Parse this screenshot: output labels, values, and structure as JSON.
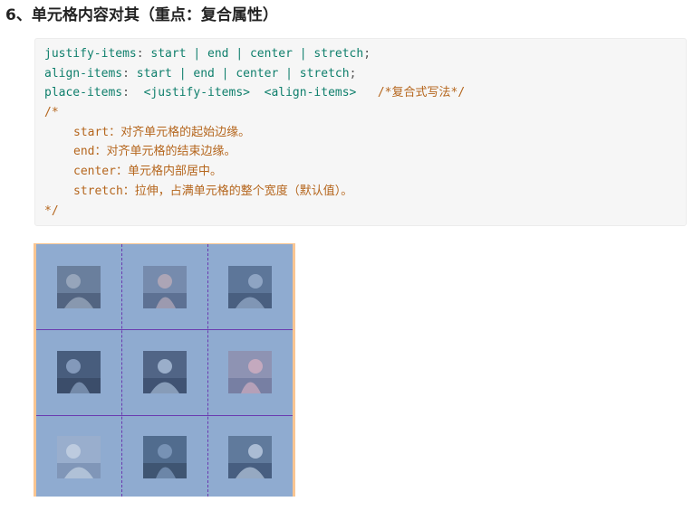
{
  "heading": "6、单元格内容对其（重点：复合属性）",
  "code": {
    "line1": {
      "prop": "justify-items",
      "colon": ":",
      "values": " start | end | center | stretch",
      "semi": ";"
    },
    "line2": {
      "prop": "align-items",
      "colon": ":",
      "values": " start | end | center | stretch",
      "semi": ";"
    },
    "line3": {
      "prop": "place-items",
      "colon": ":",
      "values": "  <justify-items>  <align-items>   ",
      "comment": "/*复合式写法*/"
    },
    "comment_open": "/*",
    "items": [
      {
        "key": "start",
        "text": "：对齐单元格的起始边缘。"
      },
      {
        "key": "end",
        "text": "：对齐单元格的结束边缘。"
      },
      {
        "key": "center",
        "text": "：单元格内部居中。"
      },
      {
        "key": "stretch",
        "text": "：拉伸，占满单元格的整个宽度（默认值）。"
      }
    ],
    "comment_close": "*/"
  },
  "colors": {
    "property": "#0f7f6c",
    "comment": "#b5661d",
    "grid_background": "#8fabd0",
    "grid_border": "#f9c592",
    "grid_lines": "#6a3bb0"
  },
  "grid": {
    "rows": 3,
    "columns": 3,
    "cells": [
      {
        "icon": "photo-icon"
      },
      {
        "icon": "photo-icon"
      },
      {
        "icon": "photo-icon"
      },
      {
        "icon": "photo-icon"
      },
      {
        "icon": "photo-icon"
      },
      {
        "icon": "photo-icon"
      },
      {
        "icon": "photo-icon"
      },
      {
        "icon": "photo-icon"
      },
      {
        "icon": "photo-icon"
      }
    ]
  }
}
